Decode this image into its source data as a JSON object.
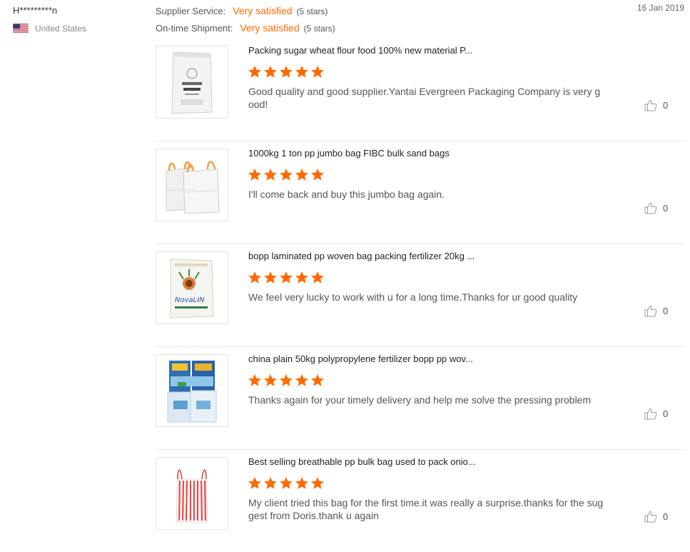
{
  "buyer": {
    "name": "H*********n",
    "country": "United States",
    "flag_icon": "us-flag-icon"
  },
  "ratings": [
    {
      "label": "Supplier Service:",
      "value": "Very satisfied",
      "stars": "(5 stars)"
    },
    {
      "label": "On-time Shipment:",
      "value": "Very satisfied",
      "stars": "(5 stars)"
    }
  ],
  "date": "16 Jan 2019",
  "colors": {
    "accent": "#ff6a00",
    "star": "#ff6a00",
    "divider": "#e8e8e8"
  },
  "reviews": [
    {
      "product_title": "Packing sugar wheat flour food 100% new material P...",
      "stars": 5,
      "text": "Good quality and good supplier.Yantai Evergreen Packaging Company is very good!",
      "likes": "0",
      "image": "flour-bag-image"
    },
    {
      "product_title": "1000kg 1 ton pp jumbo bag FIBC bulk sand bags",
      "stars": 5,
      "text": "I'll come back and buy this jumbo bag again.",
      "likes": "0",
      "image": "jumbo-bags-image"
    },
    {
      "product_title": "bopp laminated pp woven bag packing fertilizer 20kg ...",
      "stars": 5,
      "text": "We feel very lucky to work with u for a long time.Thanks for ur good quality",
      "likes": "0",
      "image": "fertilizer-bag-image"
    },
    {
      "product_title": "china plain 50kg polypropylene fertilizer bopp pp wov...",
      "stars": 5,
      "text": "Thanks again for your timely delivery and help me solve the pressing problem",
      "likes": "0",
      "image": "printed-bags-image"
    },
    {
      "product_title": "Best selling breathable pp bulk bag used to pack onio...",
      "stars": 5,
      "text": "My client tried this bag for the first time.it was really a surprise.thanks for the suggest from Doris.thank u again",
      "likes": "0",
      "image": "onion-bulk-bag-image"
    }
  ]
}
